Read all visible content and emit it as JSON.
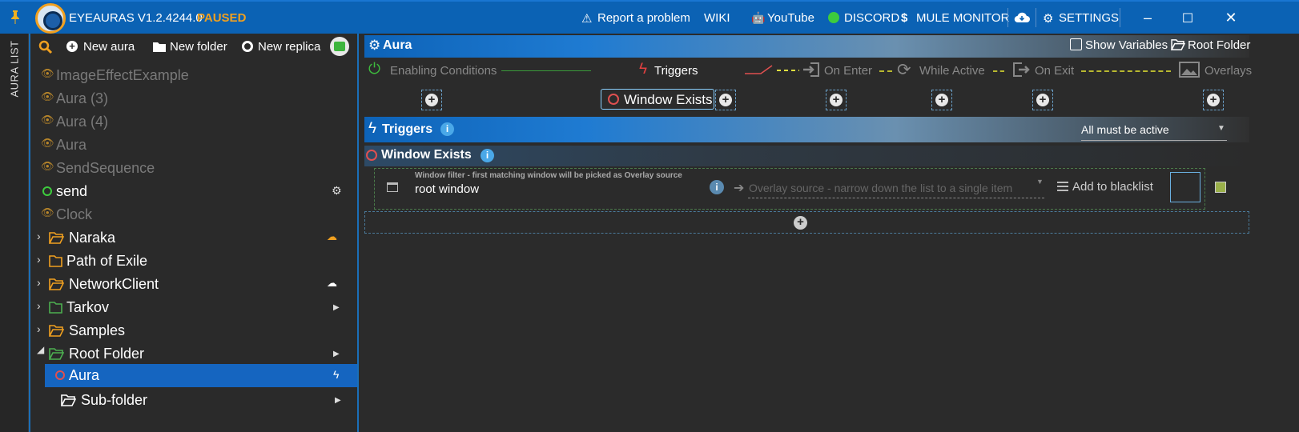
{
  "titlebar": {
    "app_title": "EYEAURAS V1.2.4244.0",
    "status": "PAUSED",
    "report": "Report a problem",
    "wiki": "WIKI",
    "youtube": "YouTube",
    "discord": "DISCORD",
    "mule": "MULE MONITOR",
    "settings": "SETTINGS",
    "status_color": "#f0a020"
  },
  "leftstrip": {
    "label": "AURA LIST"
  },
  "toolbar": {
    "new_aura": "New aura",
    "new_folder": "New folder",
    "new_replica": "New replica"
  },
  "tree": [
    {
      "label": "ImageEffectExample"
    },
    {
      "label": "Aura (3)"
    },
    {
      "label": "Aura (4)"
    },
    {
      "label": "Aura"
    },
    {
      "label": "SendSequence"
    },
    {
      "label": "send"
    },
    {
      "label": "Clock"
    },
    {
      "label": "Naraka"
    },
    {
      "label": "Path of Exile"
    },
    {
      "label": "NetworkClient"
    },
    {
      "label": "Tarkov"
    },
    {
      "label": "Samples"
    },
    {
      "label": "Root Folder"
    },
    {
      "label": "Aura"
    },
    {
      "label": "Sub-folder"
    }
  ],
  "aura_header": {
    "title": "Aura",
    "show_variables": "Show Variables",
    "root_folder": "Root Folder"
  },
  "pipeline": {
    "enabling": "Enabling Conditions",
    "triggers": "Triggers",
    "on_enter": "On Enter",
    "while_active": "While Active",
    "on_exit": "On Exit",
    "overlays": "Overlays",
    "window_exists_chip": "Window Exists"
  },
  "triggers_section": {
    "title": "Triggers",
    "mode": "All must be active"
  },
  "window_exists": {
    "title": "Window Exists",
    "filter_caption": "Window filter - first matching window will be picked as Overlay source",
    "filter_value": "root window",
    "overlay_placeholder": "Overlay source - narrow down the list to a single item",
    "blacklist": "Add to blacklist"
  },
  "colors": {
    "accent": "#1976d2",
    "selected": "#1565c0",
    "folder": "#f0a020",
    "green_folder": "#4caf50"
  }
}
